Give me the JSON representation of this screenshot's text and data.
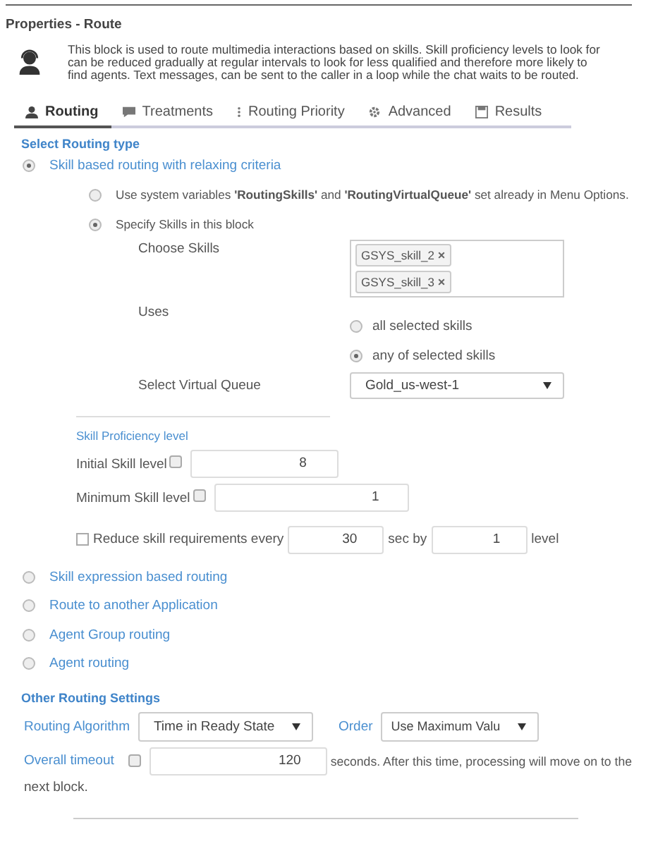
{
  "title": "Properties - Route",
  "description": "This block is used to route multimedia interactions based on skills. Skill proficiency levels to look for can be reduced gradually at regular intervals to look for less qualified and therefore more likely to find agents. Text messages, can be sent to the caller in a loop while the chat waits to be routed.",
  "tabs": [
    {
      "label": "Routing",
      "selected": true
    },
    {
      "label": "Treatments",
      "selected": false
    },
    {
      "label": "Routing Priority",
      "selected": false
    },
    {
      "label": "Advanced",
      "selected": false
    },
    {
      "label": "Results",
      "selected": false
    }
  ],
  "section_title": "Select Routing type",
  "routing_types": [
    {
      "label": "Skill based routing with relaxing criteria",
      "selected": true,
      "details": {
        "sources": [
          {
            "label": "Use system variables **'RoutingSkills'** and **'RoutingVirtualQueue'** set already in Menu Options.",
            "selected": false
          },
          {
            "label": "Specify Skills in this block",
            "selected": true
          }
        ],
        "choose_skills_label": "Choose Skills",
        "skills": [
          {
            "label": "GSYS_skill_2",
            "remove": "×"
          },
          {
            "label": "GSYS_skill_3",
            "remove": "×"
          }
        ],
        "uses_label": "Uses",
        "uses_options": [
          {
            "label": "all selected skills",
            "selected": false
          },
          {
            "label": "any of selected skills",
            "selected": true
          }
        ],
        "virtual_queue_label": "Select Virtual Queue",
        "virtual_queue": "Gold_us-west-1",
        "proficiency_title": "Skill Proficiency level",
        "levels": [
          {
            "label": "Initial Skill level",
            "checked": false,
            "value": "8"
          },
          {
            "label": "Minimum Skill level",
            "checked": false,
            "value": "1"
          }
        ],
        "reduce": {
          "checked": false,
          "prefix": "Reduce skill requirements every",
          "seconds": "30",
          "middle": "sec by",
          "step": "1",
          "suffix": "level"
        }
      }
    },
    {
      "label": "Skill expression based routing",
      "selected": false
    },
    {
      "label": "Route to another Application",
      "selected": false
    },
    {
      "label": "Agent Group routing",
      "selected": false
    },
    {
      "label": "Agent routing",
      "selected": false
    }
  ],
  "other": {
    "title": "Other Routing Settings",
    "algorithm_label": "Routing Algorithm",
    "algorithm": "Time in Ready State",
    "order_label": "Order",
    "order": "Use Maximum Valu",
    "timeout_label": "Overall timeout",
    "timeout_checked": false,
    "timeout": "120",
    "timeout_note": [
      "seconds. After this time, processing will move on to the",
      "next block."
    ]
  }
}
